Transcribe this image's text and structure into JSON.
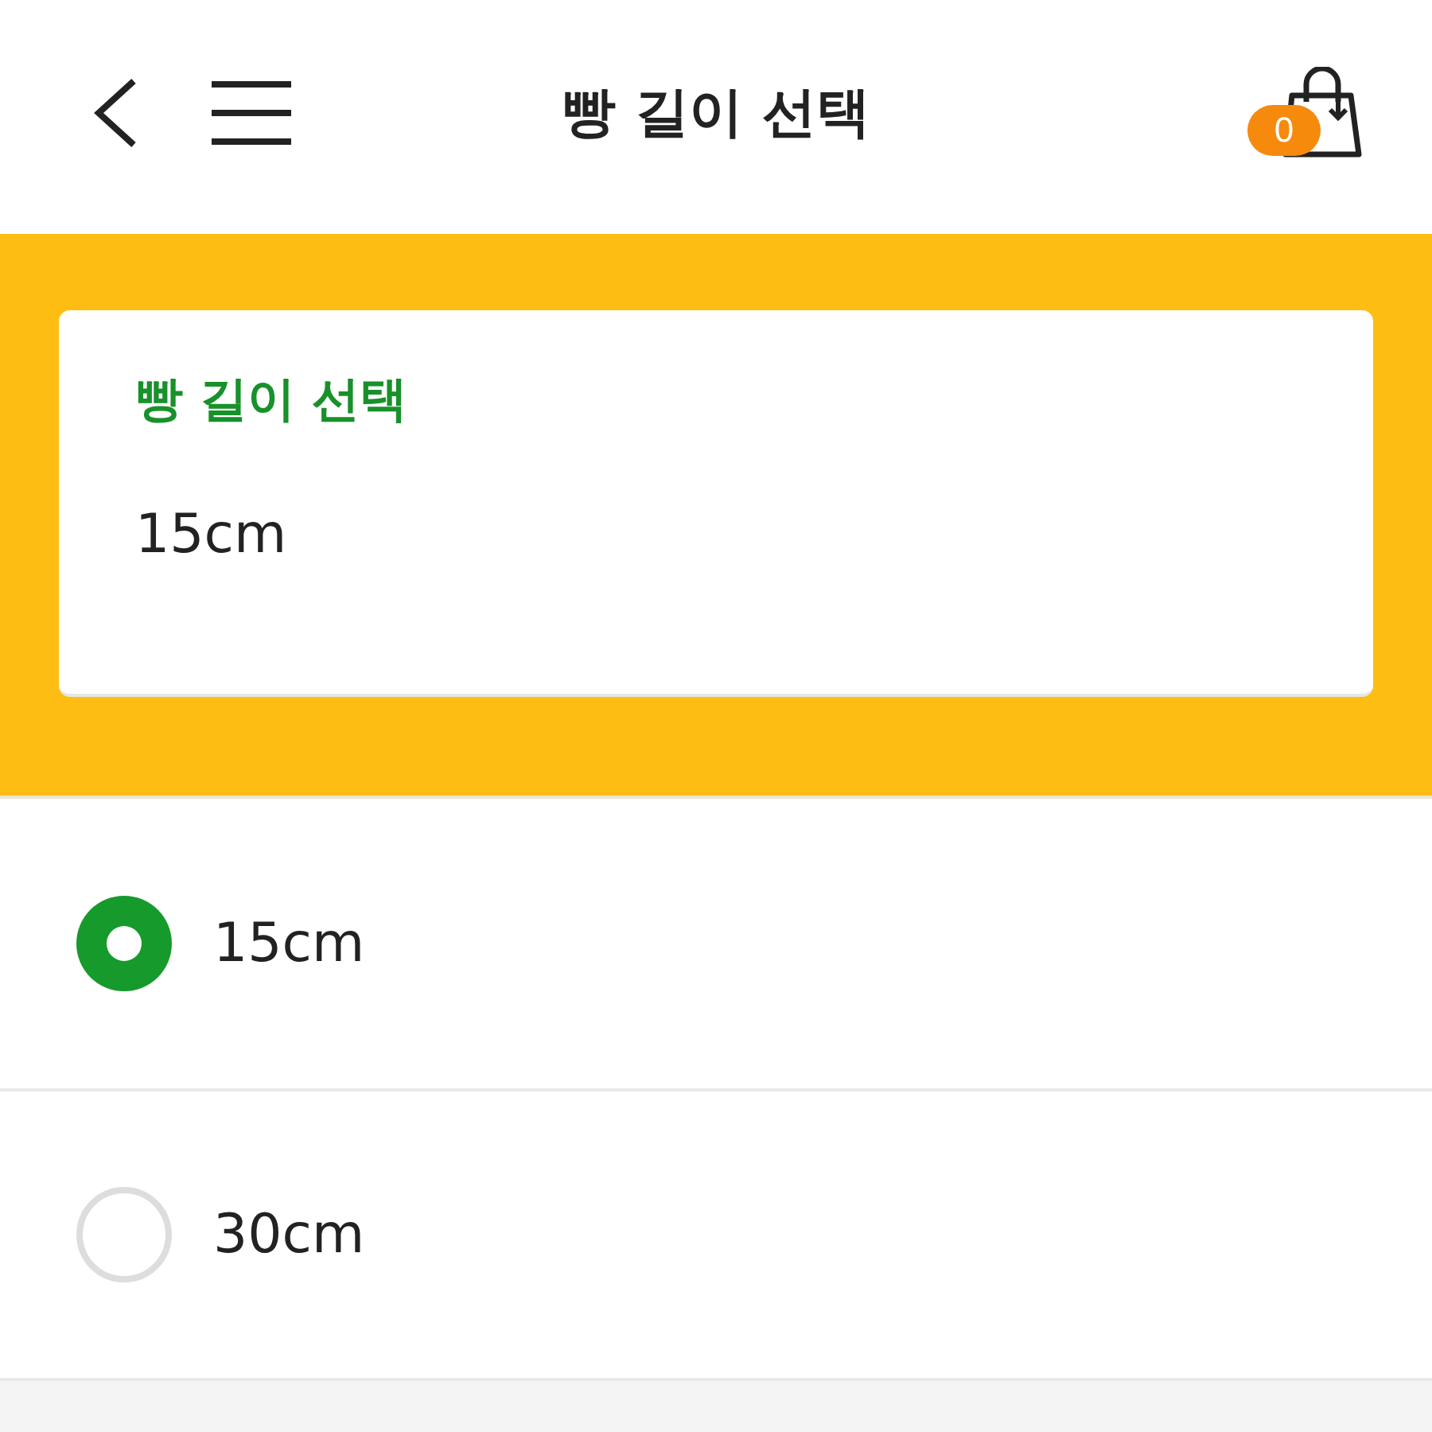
{
  "header": {
    "title": "빵 길이 선택",
    "cart_count": "0"
  },
  "selection_card": {
    "label": "빵 길이 선택",
    "value": "15cm"
  },
  "options": [
    {
      "label": "15cm",
      "selected": true
    },
    {
      "label": "30cm",
      "selected": false
    }
  ]
}
